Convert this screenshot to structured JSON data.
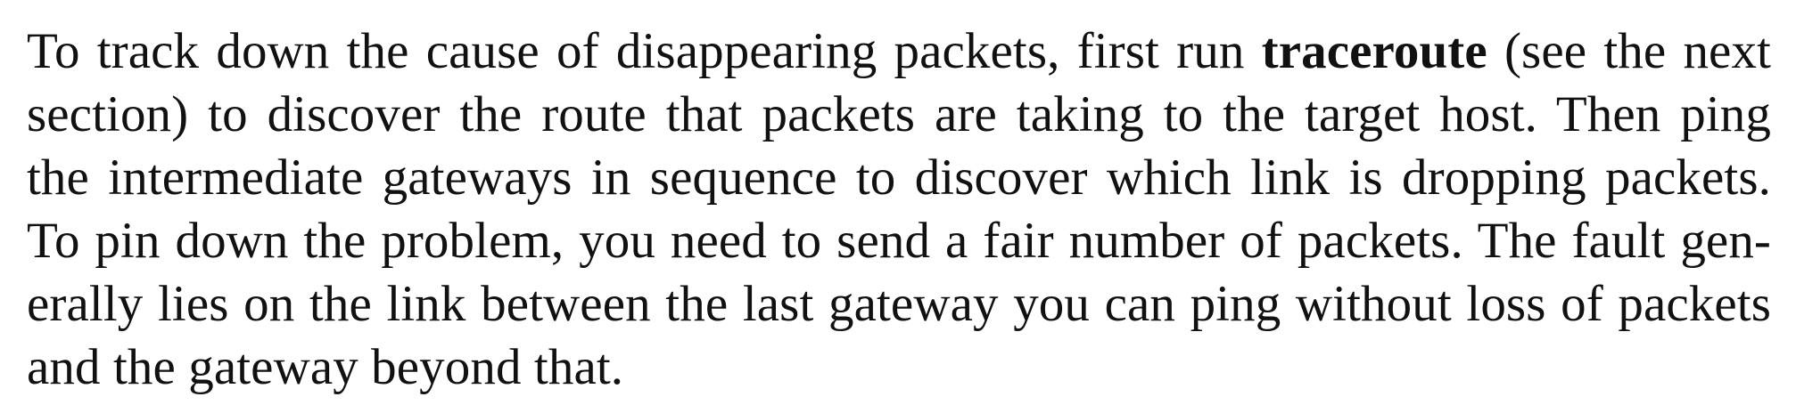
{
  "paragraph": {
    "line1": {
      "before": "To track down the cause of disappearing packets, first run ",
      "command": "traceroute",
      "after": " (see the next"
    },
    "line2": "section) to discover the route that packets are taking to the target host. Then ping",
    "line3": "the intermediate gateways in sequence to discover which link is dropping packets.",
    "line4": "To pin down the problem, you need to send a fair number of packets. The fault gen-",
    "line5": "erally lies on the link between the last gateway you can ping without loss of packets",
    "line6": "and the gateway beyond that."
  }
}
